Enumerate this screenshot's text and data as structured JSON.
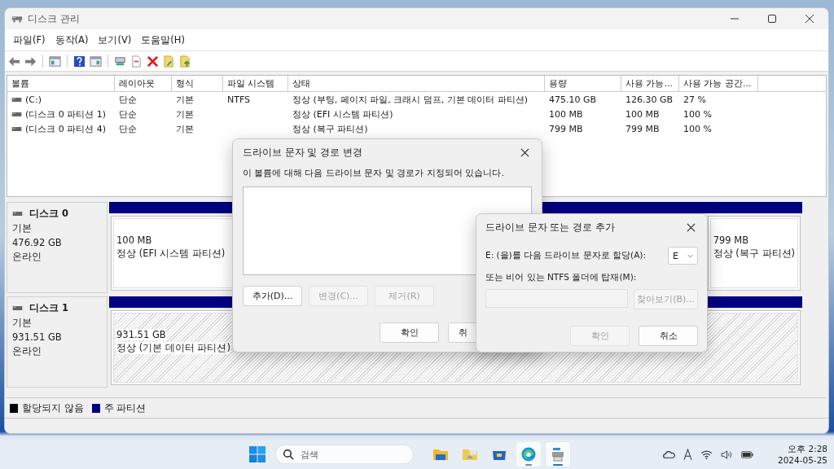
{
  "window": {
    "title": "디스크 관리"
  },
  "menu": [
    "파일(F)",
    "동작(A)",
    "보기(V)",
    "도움말(H)"
  ],
  "volume_list": {
    "columns": [
      "볼륨",
      "레이아웃",
      "형식",
      "파일 시스템",
      "상태",
      "용량",
      "사용 가능...",
      "사용 가능 공간..."
    ],
    "rows": [
      {
        "volume": "(C:)",
        "layout": "단순",
        "type": "기본",
        "file_system": "NTFS",
        "status": "정상 (부팅, 페이지 파일, 크래시 덤프, 기본 데이터 파티션)",
        "capacity": "475.10 GB",
        "free": "126.30 GB",
        "free_percent": "27 %"
      },
      {
        "volume": "(디스크 0 파티션 1)",
        "layout": "단순",
        "type": "기본",
        "status": "정상 (EFI 시스템 파티션)",
        "capacity": "100 MB",
        "free": "100 MB",
        "free_percent": "100 %"
      },
      {
        "volume": "(디스크 0 파티션 4)",
        "layout": "단순",
        "type": "기본",
        "status": "정상 (복구 파티션)",
        "capacity": "799 MB",
        "free": "799 MB",
        "free_percent": "100 %"
      }
    ]
  },
  "disks": [
    {
      "name": "디스크 0",
      "type": "기본",
      "size": "476.92 GB",
      "status": "온라인",
      "partitions": [
        {
          "size": "100 MB",
          "status": "정상 (EFI 시스템 파티션)",
          "selected": false
        },
        {
          "size": "799 MB",
          "status": "정상 (복구 파티션)",
          "selected": false
        }
      ]
    },
    {
      "name": "디스크 1",
      "type": "기본",
      "size": "931.51 GB",
      "status": "온라인",
      "partitions": [
        {
          "size": "931.51 GB",
          "status": "정상 (기본 데이터 파티션)",
          "selected": true
        }
      ]
    }
  ],
  "legend": [
    {
      "label": "할당되지 않음",
      "color": "#000000"
    },
    {
      "label": "주 파티션",
      "color": "#000080"
    }
  ],
  "change_dialog": {
    "title": "드라이브 문자 및 경로 변경",
    "message": "이 볼륨에 대해 다음 드라이브 문자 및 경로가 지정되어 있습니다.",
    "actions": [
      {
        "label": "추가(D)...",
        "disabled": false
      },
      {
        "label": "변경(C)...",
        "disabled": true
      },
      {
        "label": "제거(R)",
        "disabled": true
      }
    ],
    "buttons": [
      {
        "label": "확인",
        "disabled": false
      },
      {
        "label": "취"
      }
    ]
  },
  "add_dialog": {
    "title": "드라이브 문자 또는 경로 추가",
    "assign_label": "E: (을)를 다음 드라이브 문자로 할당(A):",
    "drive_letter": "E",
    "mount_label": "또는 비어 있는 NTFS 폴더에 탑재(M):",
    "mount_path": {
      "disabled": true
    },
    "browse": {
      "label": "찾아보기(B)...",
      "disabled": true
    },
    "buttons": [
      {
        "label": "확인",
        "disabled": true
      },
      {
        "label": "취소",
        "disabled": false
      }
    ]
  },
  "taskbar": {
    "search": {
      "placeholder": "검색"
    },
    "apps": [
      {
        "kind": "files",
        "open": false,
        "selected": false
      },
      {
        "kind": "folder",
        "open": false,
        "selected": false
      },
      {
        "kind": "store",
        "open": false,
        "selected": false
      },
      {
        "kind": "browser",
        "open": true,
        "selected": false
      },
      {
        "kind": "disk",
        "open": true,
        "selected": true
      }
    ],
    "time": "오후 2:28",
    "date": "2024-05-25"
  }
}
